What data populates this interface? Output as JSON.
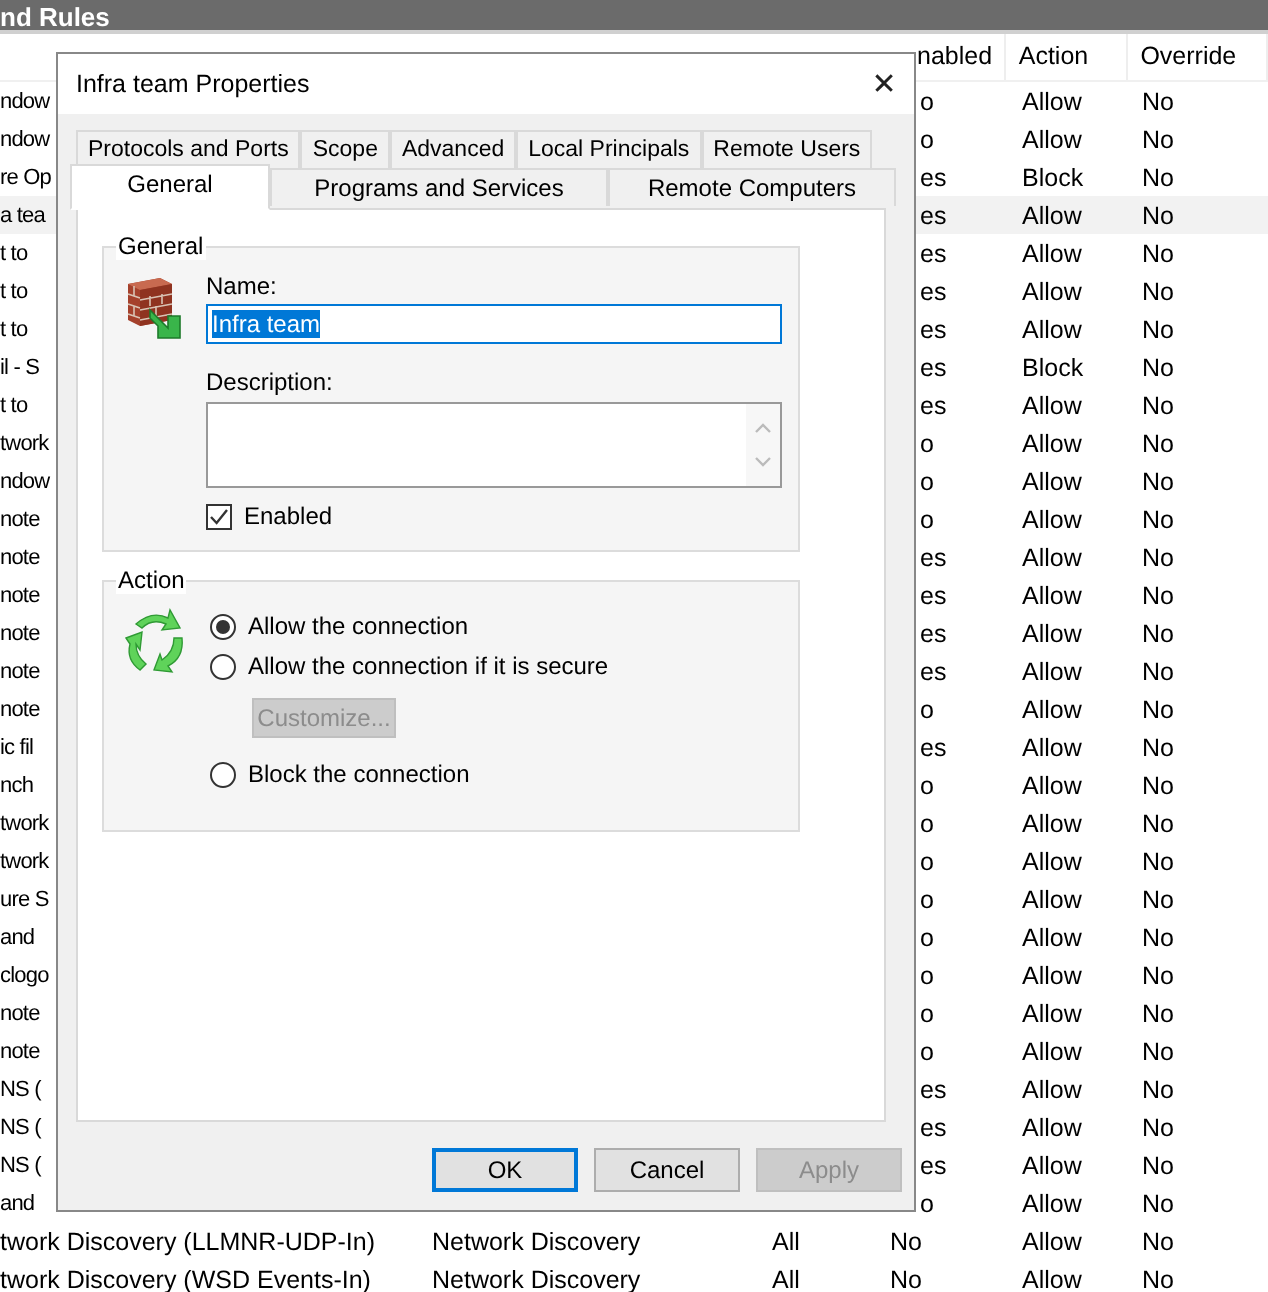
{
  "window": {
    "title": "nd Rules"
  },
  "table": {
    "columns": [
      {
        "label": "nabled"
      },
      {
        "label": "Action"
      },
      {
        "label": "Override"
      }
    ],
    "rows": [
      {
        "kind": "partial",
        "name": "ndow",
        "enabled": "o",
        "action": "Allow",
        "override": "No",
        "selected": false
      },
      {
        "kind": "partial",
        "name": "ndow",
        "enabled": "o",
        "action": "Allow",
        "override": "No",
        "selected": false
      },
      {
        "kind": "partial",
        "name": "re Op",
        "enabled": "es",
        "action": "Block",
        "override": "No",
        "selected": false
      },
      {
        "kind": "partial",
        "name": "a tea",
        "enabled": "es",
        "action": "Allow",
        "override": "No",
        "selected": true
      },
      {
        "kind": "partial",
        "name": "t to",
        "enabled": "es",
        "action": "Allow",
        "override": "No",
        "selected": false
      },
      {
        "kind": "partial",
        "name": "t to",
        "enabled": "es",
        "action": "Allow",
        "override": "No",
        "selected": false
      },
      {
        "kind": "partial",
        "name": "t to",
        "enabled": "es",
        "action": "Allow",
        "override": "No",
        "selected": false
      },
      {
        "kind": "partial",
        "name": "il - S",
        "enabled": "es",
        "action": "Block",
        "override": "No",
        "selected": false
      },
      {
        "kind": "partial",
        "name": "t to",
        "enabled": "es",
        "action": "Allow",
        "override": "No",
        "selected": false
      },
      {
        "kind": "partial",
        "name": "twork",
        "enabled": "o",
        "action": "Allow",
        "override": "No",
        "selected": false
      },
      {
        "kind": "partial",
        "name": "ndow",
        "enabled": "o",
        "action": "Allow",
        "override": "No",
        "selected": false
      },
      {
        "kind": "partial",
        "name": "note",
        "enabled": "o",
        "action": "Allow",
        "override": "No",
        "selected": false
      },
      {
        "kind": "partial",
        "name": "note",
        "enabled": "es",
        "action": "Allow",
        "override": "No",
        "selected": false
      },
      {
        "kind": "partial",
        "name": "note",
        "enabled": "es",
        "action": "Allow",
        "override": "No",
        "selected": false
      },
      {
        "kind": "partial",
        "name": "note",
        "enabled": "es",
        "action": "Allow",
        "override": "No",
        "selected": false
      },
      {
        "kind": "partial",
        "name": "note",
        "enabled": "es",
        "action": "Allow",
        "override": "No",
        "selected": false
      },
      {
        "kind": "partial",
        "name": "note",
        "enabled": "o",
        "action": "Allow",
        "override": "No",
        "selected": false
      },
      {
        "kind": "partial",
        "name": "ic fil",
        "enabled": "es",
        "action": "Allow",
        "override": "No",
        "selected": false
      },
      {
        "kind": "partial",
        "name": "nch",
        "enabled": "o",
        "action": "Allow",
        "override": "No",
        "selected": false
      },
      {
        "kind": "partial",
        "name": "twork",
        "enabled": "o",
        "action": "Allow",
        "override": "No",
        "selected": false
      },
      {
        "kind": "partial",
        "name": "twork",
        "enabled": "o",
        "action": "Allow",
        "override": "No",
        "selected": false
      },
      {
        "kind": "partial",
        "name": "ure S",
        "enabled": "o",
        "action": "Allow",
        "override": "No",
        "selected": false
      },
      {
        "kind": "partial",
        "name": "and",
        "enabled": "o",
        "action": "Allow",
        "override": "No",
        "selected": false
      },
      {
        "kind": "partial",
        "name": "clogo",
        "enabled": "o",
        "action": "Allow",
        "override": "No",
        "selected": false
      },
      {
        "kind": "partial",
        "name": "note",
        "enabled": "o",
        "action": "Allow",
        "override": "No",
        "selected": false
      },
      {
        "kind": "partial",
        "name": "note",
        "enabled": "o",
        "action": "Allow",
        "override": "No",
        "selected": false
      },
      {
        "kind": "partial",
        "name": "NS (",
        "enabled": "es",
        "action": "Allow",
        "override": "No",
        "selected": false
      },
      {
        "kind": "partial",
        "name": "NS (",
        "enabled": "es",
        "action": "Allow",
        "override": "No",
        "selected": false
      },
      {
        "kind": "partial",
        "name": "NS (",
        "enabled": "es",
        "action": "Allow",
        "override": "No",
        "selected": false
      },
      {
        "kind": "partial",
        "name": "and",
        "enabled": "o",
        "action": "Allow",
        "override": "No",
        "selected": false
      },
      {
        "kind": "full",
        "name": "twork Discovery (LLMNR-UDP-In)",
        "group": "Network Discovery",
        "profile": "All",
        "enabled": "No",
        "action": "Allow",
        "override": "No",
        "selected": false
      },
      {
        "kind": "full",
        "name": "twork Discovery (WSD Events-In)",
        "group": "Network Discovery",
        "profile": "All",
        "enabled": "No",
        "action": "Allow",
        "override": "No",
        "selected": false
      }
    ]
  },
  "dialog": {
    "title": "Infra team Properties",
    "close": "✕",
    "tab_rows": [
      [
        {
          "label": "Protocols and Ports",
          "selected": false
        },
        {
          "label": "Scope",
          "selected": false
        },
        {
          "label": "Advanced",
          "selected": false
        },
        {
          "label": "Local Principals",
          "selected": false
        },
        {
          "label": "Remote Users",
          "selected": false
        }
      ],
      [
        {
          "label": "General",
          "selected": true
        },
        {
          "label": "Programs and Services",
          "selected": false
        },
        {
          "label": "Remote Computers",
          "selected": false
        }
      ]
    ],
    "general": {
      "title": "General",
      "name_label": "Name:",
      "name_value": "Infra team",
      "description_label": "Description:",
      "enabled": {
        "label": "Enabled",
        "checked": true
      }
    },
    "action": {
      "title": "Action",
      "options": [
        {
          "kind": "radio",
          "label": "Allow the connection",
          "selected": true
        },
        {
          "kind": "radio",
          "label": "Allow the connection if it is secure",
          "selected": false
        },
        {
          "kind": "button",
          "label": "Customize...",
          "disabled": true
        },
        {
          "kind": "radio",
          "label": "Block the connection",
          "selected": false
        }
      ]
    },
    "buttons": [
      {
        "label": "OK",
        "focused": true,
        "disabled": false
      },
      {
        "label": "Cancel",
        "focused": false,
        "disabled": false
      },
      {
        "label": "Apply",
        "focused": false,
        "disabled": true
      }
    ]
  }
}
